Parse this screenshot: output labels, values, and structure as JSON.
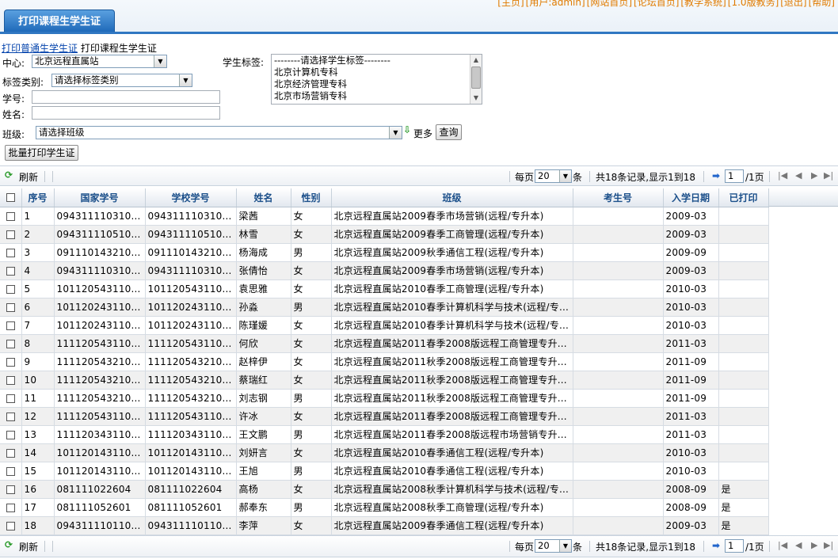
{
  "header": {
    "links": [
      "[主页]",
      "[用户:admin]",
      "[网站首页]",
      "[论坛首页]",
      "[教学系统]",
      "[1.0版教务]",
      "[退出]",
      "[帮助]"
    ],
    "tab_label": "打印课程生学生证"
  },
  "breadcrumb": {
    "link": "打印普通生学生证",
    "current": "打印课程生学生证"
  },
  "form": {
    "center_label": "中心:",
    "center_value": "北京远程直属站",
    "tag_type_label": "标签类别:",
    "tag_type_value": "请选择标签类别",
    "student_no_label": "学号:",
    "name_label": "姓名:",
    "student_tag_label": "学生标签:",
    "student_tag_options": [
      "--------请选择学生标签--------",
      "北京计算机专科",
      "北京经济管理专科",
      "北京市场营销专科"
    ],
    "class_label": "班级:",
    "class_value": "请选择班级",
    "more_label": "更多",
    "query_button": "查询",
    "batch_print_button": "批量打印学生证"
  },
  "toolbar": {
    "refresh": "刷新",
    "per_page_prefix": "每页",
    "per_page_value": "20",
    "per_page_suffix": "条",
    "summary": "共18条记录,显示1到18",
    "page_value": "1",
    "page_total": "/1页"
  },
  "table": {
    "columns": [
      "序号",
      "国家学号",
      "学校学号",
      "姓名",
      "性别",
      "班级",
      "考生号",
      "入学日期",
      "已打印"
    ],
    "rows": [
      [
        "1",
        "094311110310...",
        "094311110310...",
        "梁茜",
        "女",
        "北京远程直属站2009春季市场营销(远程/专升本)",
        "",
        "2009-03",
        ""
      ],
      [
        "2",
        "094311110510...",
        "094311110510...",
        "林雪",
        "女",
        "北京远程直属站2009春季工商管理(远程/专升本)",
        "",
        "2009-03",
        ""
      ],
      [
        "3",
        "091110143210...",
        "091110143210...",
        "杨海成",
        "男",
        "北京远程直属站2009秋季通信工程(远程/专升本)",
        "",
        "2009-09",
        ""
      ],
      [
        "4",
        "094311110310...",
        "094311110310...",
        "张倩怡",
        "女",
        "北京远程直属站2009春季市场营销(远程/专升本)",
        "",
        "2009-03",
        ""
      ],
      [
        "5",
        "101120543110...",
        "101120543110...",
        "袁思雅",
        "女",
        "北京远程直属站2010春季工商管理(远程/专升本)",
        "",
        "2010-03",
        ""
      ],
      [
        "6",
        "101120243110...",
        "101120243110...",
        "孙淼",
        "男",
        "北京远程直属站2010春季计算机科学与技术(远程/专...",
        "",
        "2010-03",
        ""
      ],
      [
        "7",
        "101120243110...",
        "101120243110...",
        "陈瑾媛",
        "女",
        "北京远程直属站2010春季计算机科学与技术(远程/专...",
        "",
        "2010-03",
        ""
      ],
      [
        "8",
        "111120543110...",
        "111120543110...",
        "何欣",
        "女",
        "北京远程直属站2011春季2008版远程工商管理专升...",
        "",
        "2011-03",
        ""
      ],
      [
        "9",
        "111120543210...",
        "111120543210...",
        "赵梓伊",
        "女",
        "北京远程直属站2011秋季2008版远程工商管理专升...",
        "",
        "2011-09",
        ""
      ],
      [
        "10",
        "111120543210...",
        "111120543210...",
        "蔡瑞红",
        "女",
        "北京远程直属站2011秋季2008版远程工商管理专升...",
        "",
        "2011-09",
        ""
      ],
      [
        "11",
        "111120543210...",
        "111120543210...",
        "刘志钢",
        "男",
        "北京远程直属站2011秋季2008版远程工商管理专升...",
        "",
        "2011-09",
        ""
      ],
      [
        "12",
        "111120543110...",
        "111120543110...",
        "许冰",
        "女",
        "北京远程直属站2011春季2008版远程工商管理专升...",
        "",
        "2011-03",
        ""
      ],
      [
        "13",
        "111120343110...",
        "111120343110...",
        "王文鹏",
        "男",
        "北京远程直属站2011春季2008版远程市场营销专升...",
        "",
        "2011-03",
        ""
      ],
      [
        "14",
        "101120143110...",
        "101120143110...",
        "刘妍言",
        "女",
        "北京远程直属站2010春季通信工程(远程/专升本)",
        "",
        "2010-03",
        ""
      ],
      [
        "15",
        "101120143110...",
        "101120143110...",
        "王旭",
        "男",
        "北京远程直属站2010春季通信工程(远程/专升本)",
        "",
        "2010-03",
        ""
      ],
      [
        "16",
        "081111022604",
        "081111022604",
        "高杨",
        "女",
        "北京远程直属站2008秋季计算机科学与技术(远程/专...",
        "",
        "2008-09",
        "是"
      ],
      [
        "17",
        "081111052601",
        "081111052601",
        "郝奉东",
        "男",
        "北京远程直属站2008秋季工商管理(远程/专升本)",
        "",
        "2008-09",
        "是"
      ],
      [
        "18",
        "094311110110...",
        "094311110110...",
        "李萍",
        "女",
        "北京远程直属站2009春季通信工程(远程/专升本)",
        "",
        "2009-03",
        "是"
      ]
    ]
  }
}
